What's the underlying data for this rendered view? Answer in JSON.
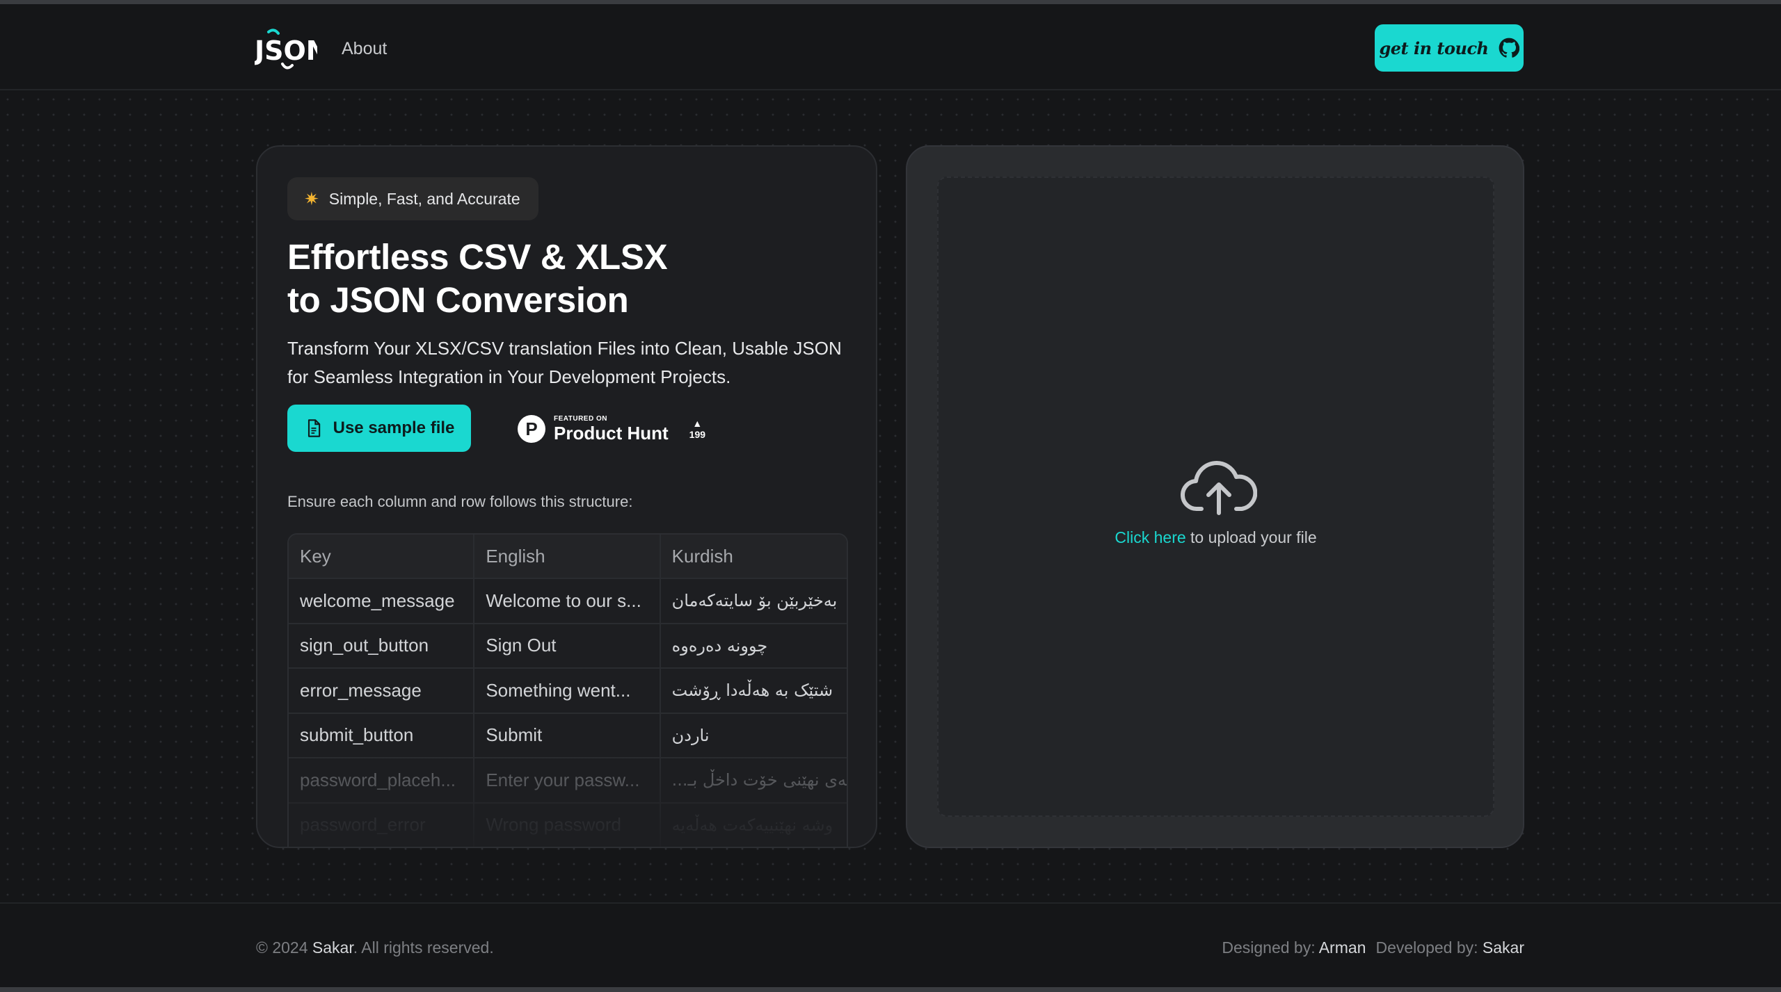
{
  "header": {
    "logo_text": "JSON",
    "nav_about": "About",
    "git_button": "get in touch"
  },
  "hero": {
    "badge": "Simple, Fast, and Accurate",
    "title_line1": "Effortless CSV & XLSX",
    "title_line2": "to JSON Conversion",
    "subtitle": "Transform Your XLSX/CSV translation Files into Clean, Usable JSON for Seamless Integration in Your Development Projects.",
    "sample_button": "Use sample file",
    "product_hunt": {
      "small": "FEATURED ON",
      "big": "Product Hunt",
      "votes": "199"
    },
    "structure_note": "Ensure each column and row follows this structure:"
  },
  "table": {
    "headers": [
      "Key",
      "English",
      "Kurdish"
    ],
    "rows": [
      [
        "welcome_message",
        "Welcome to our s...",
        "بەخێربێن بۆ سایتەکەمان"
      ],
      [
        "sign_out_button",
        "Sign Out",
        "چوونە دەرەوە"
      ],
      [
        "error_message",
        "Something went...",
        "شتێک بە هەڵەدا ڕۆشت"
      ],
      [
        "submit_button",
        "Submit",
        "ناردن"
      ],
      [
        "password_placeh...",
        "Enter your passw...",
        "وشەی نهێنی خۆت داخڵ بـ..."
      ],
      [
        "password_error",
        "Wrong password",
        "وشە نهێنییەکەت هەڵەیە"
      ]
    ]
  },
  "upload": {
    "link": "Click here",
    "text": " to upload your file"
  },
  "footer": {
    "copy_prefix": "© 2024 ",
    "owner": "Sakar",
    "copy_suffix": ". All rights reserved.",
    "designed_label": "Designed by: ",
    "designer": "Arman",
    "developed_label": "Developed by: ",
    "developer": "Sakar"
  },
  "colors": {
    "accent": "#1ad8d0",
    "background": "#151618",
    "card": "#1d1e21"
  }
}
